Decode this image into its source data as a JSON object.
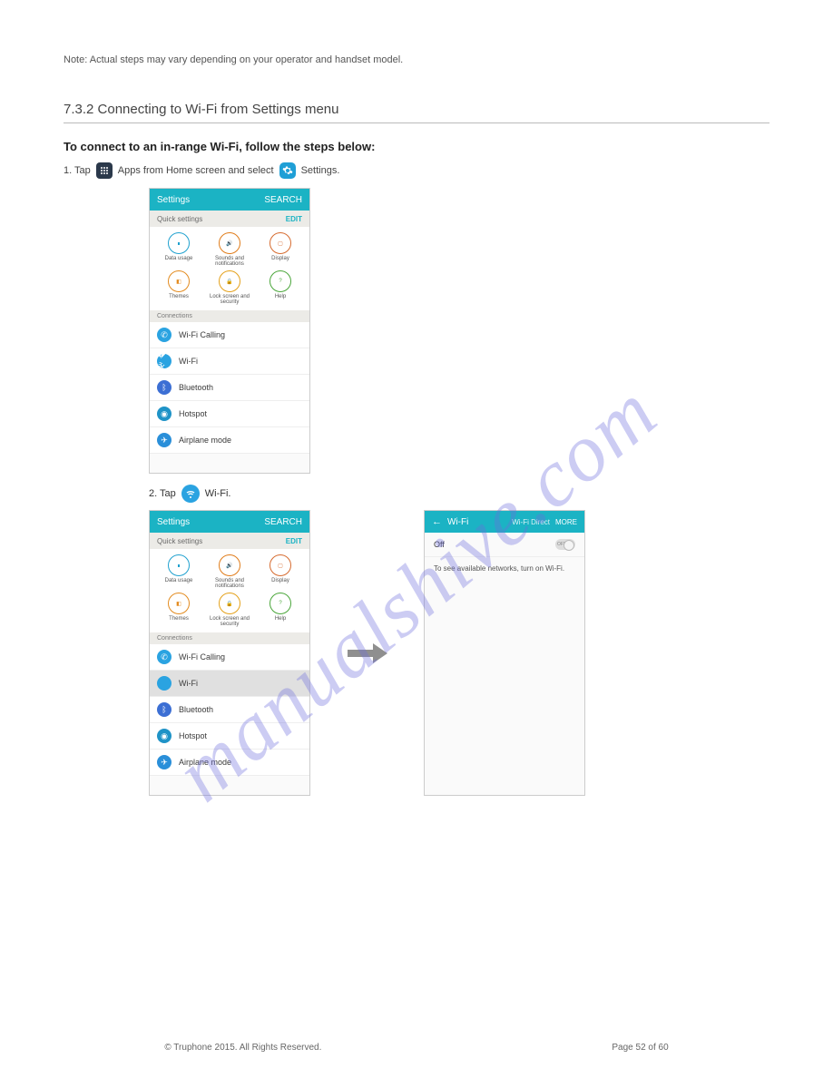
{
  "watermark": "manualshive.com",
  "top_note": "Note: Actual steps may vary depending on your operator and handset model.",
  "section_title": "7.3.2 Connecting to Wi-Fi from Settings menu",
  "subheading": "To connect to an in-range Wi-Fi, follow the steps below:",
  "steps": {
    "step1_prefix": "1. Tap ",
    "step1_mid": " Apps from Home screen and select ",
    "step1_suffix": " Settings.",
    "step2_prefix": "2. Tap ",
    "step2_suffix": " Wi-Fi."
  },
  "settings_screen": {
    "title": "Settings",
    "search": "SEARCH",
    "quick_settings_label": "Quick settings",
    "edit": "EDIT",
    "quick": [
      {
        "label": "Data usage",
        "color": "#1fa1cf"
      },
      {
        "label": "Sounds and notifications",
        "color": "#e07c1a"
      },
      {
        "label": "Display",
        "color": "#d66b2f"
      },
      {
        "label": "Themes",
        "color": "#e38b1f"
      },
      {
        "label": "Lock screen and security",
        "color": "#e4a11b"
      },
      {
        "label": "Help",
        "color": "#4aa63a"
      }
    ],
    "connections_label": "Connections",
    "rows": [
      {
        "label": "Wi-Fi Calling",
        "color": "#2aa3e1"
      },
      {
        "label": "Wi-Fi",
        "color": "#2aa3e1"
      },
      {
        "label": "Bluetooth",
        "color": "#3c6fd4"
      },
      {
        "label": "Hotspot",
        "color": "#1f93c7"
      },
      {
        "label": "Airplane mode",
        "color": "#2a8fd9"
      }
    ]
  },
  "wifi_screen": {
    "title": "Wi-Fi",
    "direct": "Wi-Fi Direct",
    "more": "MORE",
    "off": "Off",
    "hint": "To see available networks, turn on Wi-Fi."
  },
  "footer": {
    "copyright": "© Truphone 2015. All Rights Reserved.",
    "page": "Page 52 of 60"
  }
}
